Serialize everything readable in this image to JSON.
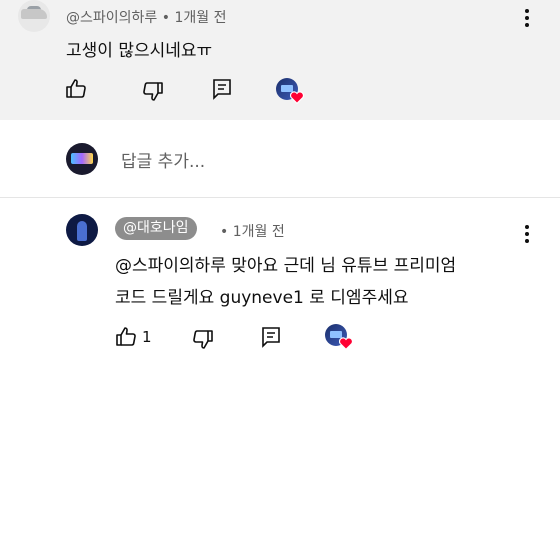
{
  "top_comment": {
    "author": "@스파이의하루",
    "separator": "•",
    "time": "1개월 전",
    "text": "고생이 많으시네요ㅠ",
    "author_avatar_icon": "car-avatar",
    "like_icon": "thumb-up-icon",
    "dislike_icon": "thumb-down-icon",
    "reply_icon": "reply-comment-icon",
    "creator_heart_icon": "creator-heart-icon",
    "heart_color": "#ff0033"
  },
  "reply_input": {
    "placeholder": "답글 추가..."
  },
  "reply": {
    "author_handle": "@대호나임",
    "separator": "•",
    "time": "1개월 전",
    "line1": "@스파이의하루 맞아요 근데 님 유튜브 프리미엄",
    "line2": "코드 드릴게요 guyneve1 로 디엠주세요",
    "like_count": "1",
    "handle_chip_color": "#8d8d8d"
  }
}
